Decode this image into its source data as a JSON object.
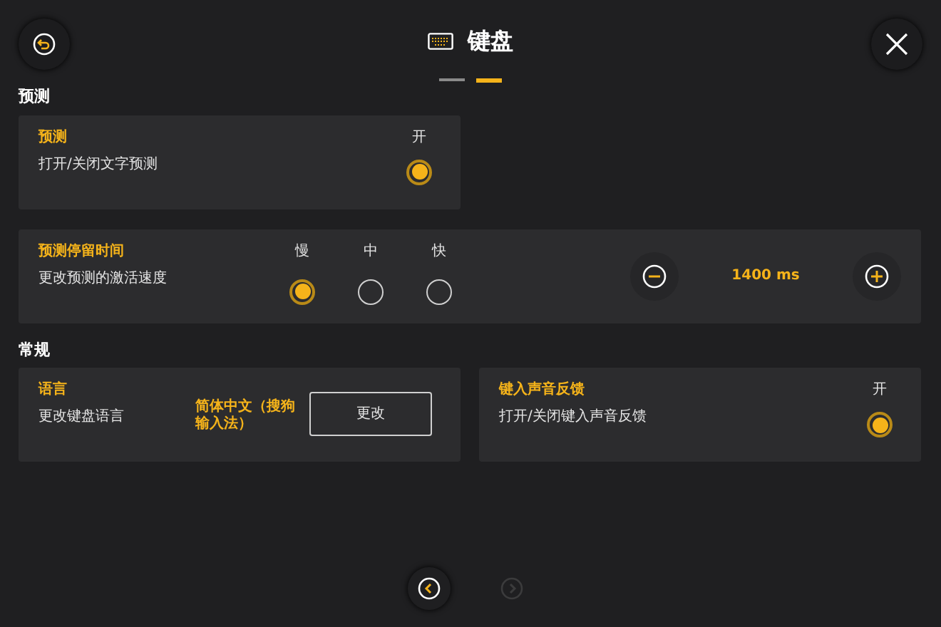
{
  "header": {
    "title": "键盘",
    "pages": [
      {
        "selected": false
      },
      {
        "selected": true
      }
    ]
  },
  "sections": [
    {
      "title": "预测",
      "cards": [
        {
          "kind": "toggle",
          "wide": false,
          "title": "预测",
          "description": "打开/关闭文字预测",
          "state_label": "开",
          "on": true
        },
        {
          "kind": "speed",
          "wide": true,
          "title": "预测停留时间",
          "description": "更改预测的激活速度",
          "options": [
            {
              "label": "慢",
              "selected": true
            },
            {
              "label": "中",
              "selected": false
            },
            {
              "label": "快",
              "selected": false
            }
          ],
          "value": "1400 ms"
        }
      ]
    },
    {
      "title": "常规",
      "cards": [
        {
          "kind": "language",
          "wide": false,
          "title": "语言",
          "description": "更改键盘语言",
          "current": "简体中文（搜狗输入法）",
          "button": "更改"
        },
        {
          "kind": "toggle",
          "wide": false,
          "title": "键入声音反馈",
          "description": "打开/关闭键入声音反馈",
          "state_label": "开",
          "on": true
        }
      ]
    }
  ],
  "footer": {
    "prev": {
      "disabled": false
    },
    "next": {
      "disabled": true
    }
  }
}
